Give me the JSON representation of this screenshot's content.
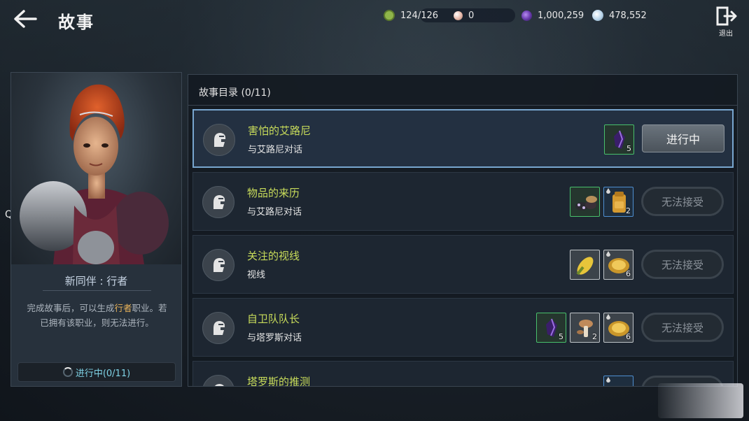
{
  "header": {
    "title": "故事",
    "exit_label": "退出",
    "qa_label": "QA"
  },
  "resources": [
    {
      "icon": "energy-icon",
      "value": "124/126",
      "color": "#8fb54a"
    },
    {
      "icon": "pearl-icon",
      "value": "0",
      "color": "#e7b7a8"
    },
    {
      "icon": "crystal-icon",
      "value": "1,000,259",
      "color": "#6b3db0"
    },
    {
      "icon": "silver-icon",
      "value": "478,552",
      "color": "#b8d4ea"
    }
  ],
  "companion": {
    "title": "新同伴 : 行者",
    "desc_line1_pre": "完成故事后，可以生成",
    "desc_highlight": "行者",
    "desc_line1_post": "职业。若",
    "desc_line2": "已拥有该职业，则无法进行。",
    "progress": "进行中(0/11)"
  },
  "story_list": {
    "header": "故事目录 (0/11)",
    "quests": [
      {
        "name": "害怕的艾路尼",
        "sub": "与艾路尼对话",
        "button": "进行中",
        "state": "active",
        "rewards": [
          {
            "icon": "purple-gem-icon",
            "count": "5",
            "rarity": "green"
          }
        ]
      },
      {
        "name": "物品的来历",
        "sub": "与艾路尼对话",
        "button": "无法接受",
        "state": "locked",
        "rewards": [
          {
            "icon": "ore-pile-icon",
            "count": "",
            "rarity": "green"
          },
          {
            "icon": "backpack-icon",
            "count": "2",
            "rarity": "blue"
          }
        ]
      },
      {
        "name": "关注的视线",
        "sub": "视线",
        "button": "无法接受",
        "state": "locked",
        "rewards": [
          {
            "icon": "corn-icon",
            "count": "",
            "rarity": "white"
          },
          {
            "icon": "coin-plate-icon",
            "count": "6",
            "rarity": "white"
          }
        ]
      },
      {
        "name": "自卫队队长",
        "sub": "与塔罗斯对话",
        "button": "无法接受",
        "state": "locked",
        "rewards": [
          {
            "icon": "purple-gem-icon",
            "count": "5",
            "rarity": "green"
          },
          {
            "icon": "mushroom-icon",
            "count": "2",
            "rarity": "white"
          },
          {
            "icon": "coin-plate-icon",
            "count": "6",
            "rarity": "white"
          }
        ]
      },
      {
        "name": "塔罗斯的推测",
        "sub": "",
        "button": "",
        "state": "partial",
        "rewards": [
          {
            "icon": "reward-icon",
            "count": "",
            "rarity": "blue"
          }
        ]
      }
    ]
  }
}
